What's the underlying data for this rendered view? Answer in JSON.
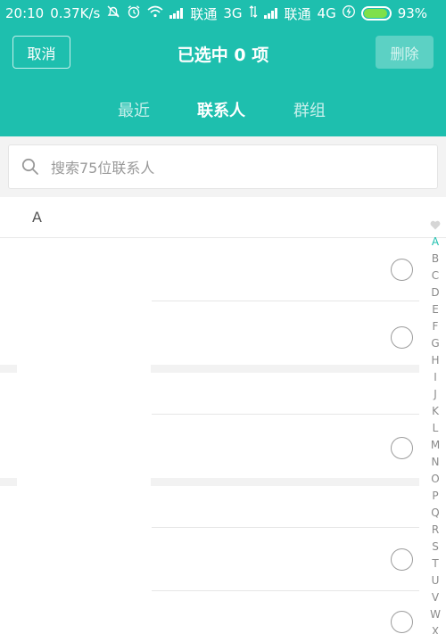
{
  "status_bar": {
    "time": "20:10",
    "speed": "0.37K/s",
    "carrier1": "联通",
    "net1": "3G",
    "carrier2": "联通",
    "net2": "4G",
    "battery_percent": "93%",
    "battery_level": 0.93,
    "icons": [
      "mute-icon",
      "alarm-icon",
      "wifi-icon",
      "signal-icon",
      "data-transfer-icon",
      "charging-icon",
      "battery-icon"
    ]
  },
  "header": {
    "cancel_label": "取消",
    "title": "已选中 0 项",
    "delete_label": "删除",
    "tabs": [
      {
        "label": "最近",
        "active": false
      },
      {
        "label": "联系人",
        "active": true
      },
      {
        "label": "群组",
        "active": false
      }
    ]
  },
  "search": {
    "placeholder": "搜索75位联系人"
  },
  "section": {
    "label": "A"
  },
  "index": {
    "favorite_icon": "heart-icon",
    "letters": [
      "A",
      "B",
      "C",
      "D",
      "E",
      "F",
      "G",
      "H",
      "I",
      "J",
      "K",
      "L",
      "M",
      "N",
      "O",
      "P",
      "Q",
      "R",
      "S",
      "T",
      "U",
      "V",
      "W",
      "X"
    ],
    "active": "A"
  },
  "colors": {
    "accent": "#1ebfae",
    "battery": "#7fe04a"
  }
}
